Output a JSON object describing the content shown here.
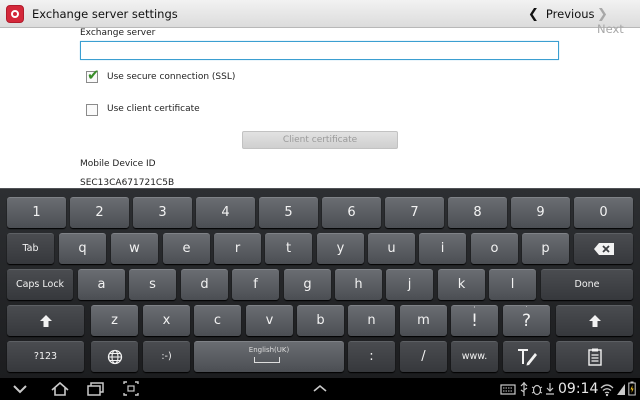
{
  "action_bar": {
    "title": "Exchange server settings",
    "previous_label": "Previous",
    "next_label": "Next"
  },
  "form": {
    "server_label": "Exchange server",
    "server_value": "",
    "ssl_label": "Use secure connection (SSL)",
    "ssl_checked": true,
    "client_cert_label": "Use client certificate",
    "client_cert_checked": false,
    "client_cert_button": "Client certificate",
    "device_id_label": "Mobile Device ID",
    "device_id_value": "SEC13CA671721C5B"
  },
  "keyboard": {
    "row1": [
      "1",
      "2",
      "3",
      "4",
      "5",
      "6",
      "7",
      "8",
      "9",
      "0"
    ],
    "row2": [
      "Tab",
      "q",
      "w",
      "e",
      "r",
      "t",
      "y",
      "u",
      "i",
      "o",
      "p"
    ],
    "row3": [
      "Caps Lock",
      "a",
      "s",
      "d",
      "f",
      "g",
      "h",
      "j",
      "k",
      "l",
      "Done"
    ],
    "row4": [
      "z",
      "x",
      "c",
      "v",
      "b",
      "n",
      "m",
      "!",
      "?"
    ],
    "row4_sup": [
      ",",
      "."
    ],
    "row5": [
      "?123",
      ":-)",
      "English(UK)",
      ":",
      "/",
      "www."
    ]
  },
  "status_bar": {
    "time": "09:14"
  }
}
